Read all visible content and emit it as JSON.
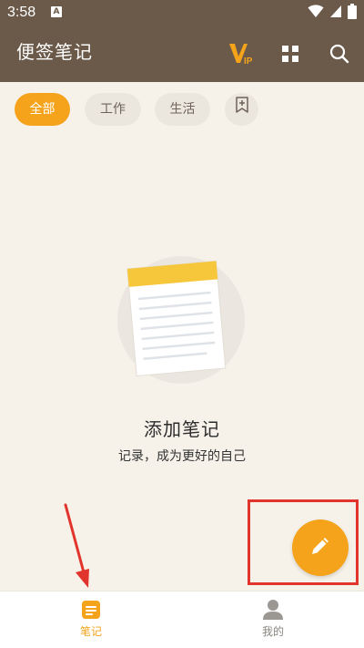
{
  "status_bar": {
    "time": "3:58",
    "notification_letter": "A"
  },
  "header": {
    "title": "便签笔记",
    "icons": [
      "vip-icon",
      "grid-icon",
      "search-icon"
    ]
  },
  "filters": {
    "chips": [
      {
        "label": "全部",
        "active": true
      },
      {
        "label": "工作",
        "active": false
      },
      {
        "label": "生活",
        "active": false
      }
    ],
    "add_icon": "bookmark-plus-icon"
  },
  "empty_state": {
    "title": "添加笔记",
    "subtitle": "记录，成为更好的自己"
  },
  "fab": {
    "icon": "pencil-icon"
  },
  "bottom_nav": {
    "items": [
      {
        "label": "笔记",
        "icon": "notes-icon",
        "active": true
      },
      {
        "label": "我的",
        "icon": "user-icon",
        "active": false
      }
    ]
  },
  "colors": {
    "header": "#6b5a4a",
    "background": "#f6f2ea",
    "accent": "#f4a31b",
    "chip_bg": "#ece7de",
    "annotation_red": "#e1342c"
  }
}
